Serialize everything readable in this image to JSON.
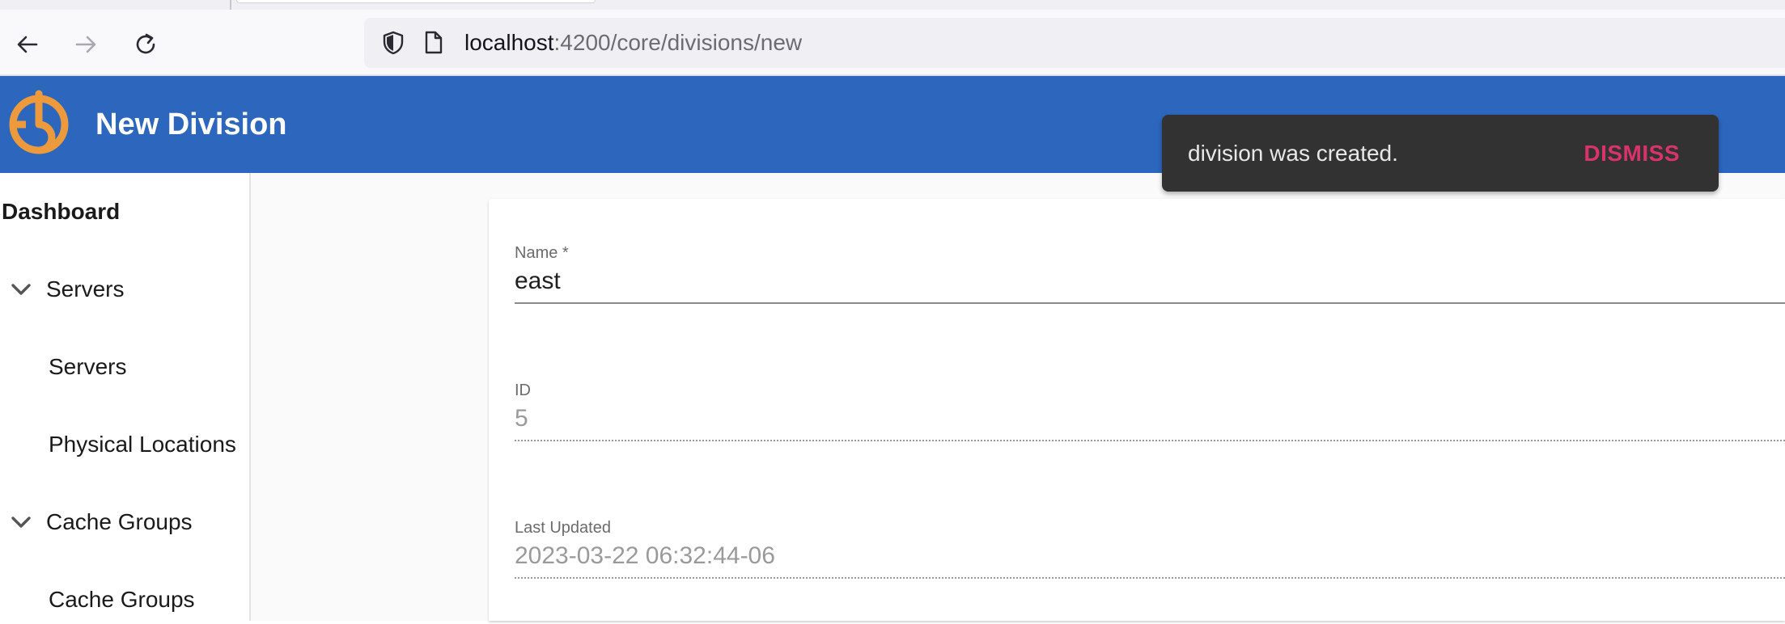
{
  "browser": {
    "url_host": "localhost",
    "url_path": ":4200/core/divisions/new",
    "back_icon": "arrow-left-icon",
    "forward_icon": "arrow-right-icon",
    "reload_icon": "reload-icon",
    "security_icon": "shield-icon",
    "page_icon": "page-icon"
  },
  "header": {
    "title": "New Division",
    "logo_icon": "app-logo",
    "background_color": "#2d66bd"
  },
  "sidebar": {
    "dashboard": "Dashboard",
    "groups": [
      {
        "label": "Servers",
        "expanded": true,
        "children": [
          "Servers",
          "Physical Locations"
        ]
      },
      {
        "label": "Cache Groups",
        "expanded": true,
        "children": [
          "Cache Groups"
        ]
      }
    ]
  },
  "form": {
    "name": {
      "label": "Name *",
      "value": "east"
    },
    "id": {
      "label": "ID",
      "value": "5"
    },
    "last_updated": {
      "label": "Last Updated",
      "value": "2023-03-22 06:32:44-06"
    }
  },
  "snackbar": {
    "message": "division was created.",
    "action": "DISMISS",
    "action_color": "#d8336a"
  }
}
